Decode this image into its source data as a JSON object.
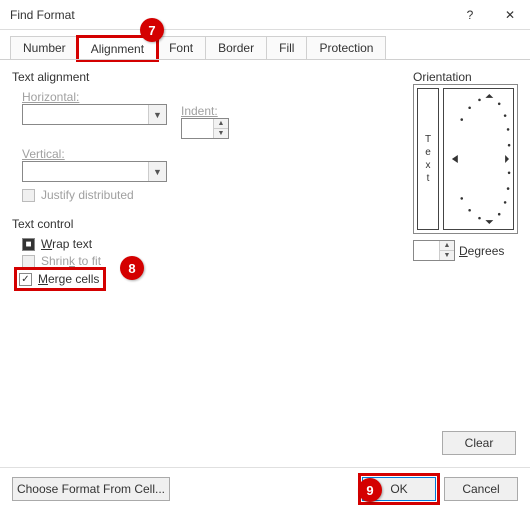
{
  "window": {
    "title": "Find Format",
    "help": "?",
    "close": "✕"
  },
  "tabs": [
    {
      "label": "Number"
    },
    {
      "label": "Alignment"
    },
    {
      "label": "Font"
    },
    {
      "label": "Border"
    },
    {
      "label": "Fill"
    },
    {
      "label": "Protection"
    }
  ],
  "active_tab": 1,
  "text_alignment": {
    "legend": "Text alignment",
    "horizontal_label": "Horizontal:",
    "indent_label": "Indent:",
    "indent_value": "",
    "vertical_label": "Vertical:",
    "justify_label": "Justify distributed",
    "justify_enabled": false
  },
  "text_control": {
    "legend": "Text control",
    "wrap_label": "Wrap text",
    "wrap_state": "filled",
    "shrink_label": "Shrink to fit",
    "shrink_enabled": false,
    "merge_label": "Merge cells",
    "merge_checked": true
  },
  "orientation": {
    "legend": "Orientation",
    "vtext": "Text",
    "degrees_label": "Degrees",
    "degrees_value": ""
  },
  "buttons": {
    "clear": "Clear",
    "choose": "Choose Format From Cell...",
    "ok": "OK",
    "cancel": "Cancel"
  },
  "callouts": {
    "c7": "7",
    "c8": "8",
    "c9": "9"
  }
}
